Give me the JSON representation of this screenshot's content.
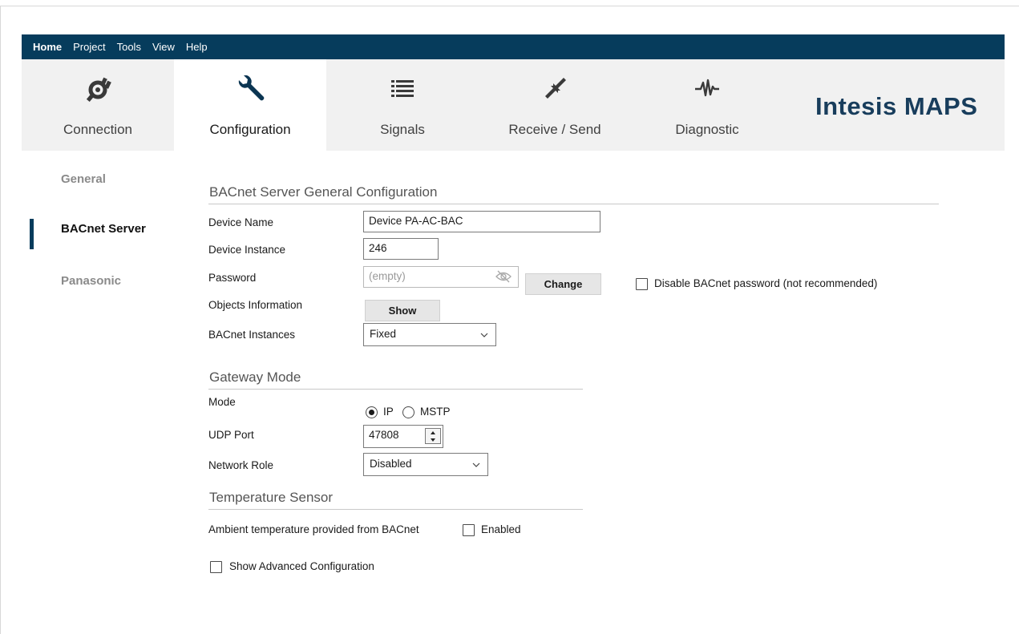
{
  "menu": {
    "items": [
      "Home",
      "Project",
      "Tools",
      "View",
      "Help"
    ]
  },
  "ribbon": {
    "tabs": [
      {
        "label": "Connection",
        "icon": "plug-icon"
      },
      {
        "label": "Configuration",
        "icon": "wrench-icon"
      },
      {
        "label": "Signals",
        "icon": "list-icon"
      },
      {
        "label": "Receive / Send",
        "icon": "transfer-arrows-icon"
      },
      {
        "label": "Diagnostic",
        "icon": "waveform-icon"
      }
    ],
    "active_tab": "Configuration",
    "brand": "Intesis MAPS"
  },
  "sidebar": {
    "items": [
      {
        "label": "General"
      },
      {
        "label": "BACnet Server"
      },
      {
        "label": "Panasonic"
      }
    ],
    "active": "BACnet Server"
  },
  "general": {
    "title": "BACnet Server General Configuration",
    "device_name_label": "Device Name",
    "device_name_value": "Device PA-AC-BAC",
    "device_instance_label": "Device Instance",
    "device_instance_value": "246",
    "password_label": "Password",
    "password_placeholder": "(empty)",
    "change_button": "Change",
    "disable_password_label": "Disable BACnet password (not recommended)",
    "objects_info_label": "Objects Information",
    "show_button": "Show",
    "instances_label": "BACnet Instances",
    "instances_value": "Fixed"
  },
  "gateway": {
    "title": "Gateway Mode",
    "mode_label": "Mode",
    "mode_options": [
      "IP",
      "MSTP"
    ],
    "mode_selected": "IP",
    "udp_port_label": "UDP Port",
    "udp_port_value": "47808",
    "network_role_label": "Network Role",
    "network_role_value": "Disabled"
  },
  "temperature": {
    "title": "Temperature Sensor",
    "ambient_label": "Ambient temperature provided from BACnet",
    "enabled_label": "Enabled"
  },
  "advanced": {
    "show_advanced_label": "Show Advanced Configuration"
  },
  "colors": {
    "menubar": "#063c5c",
    "brand": "#183d5c",
    "ribbon_bg": "#f1f1f1"
  }
}
